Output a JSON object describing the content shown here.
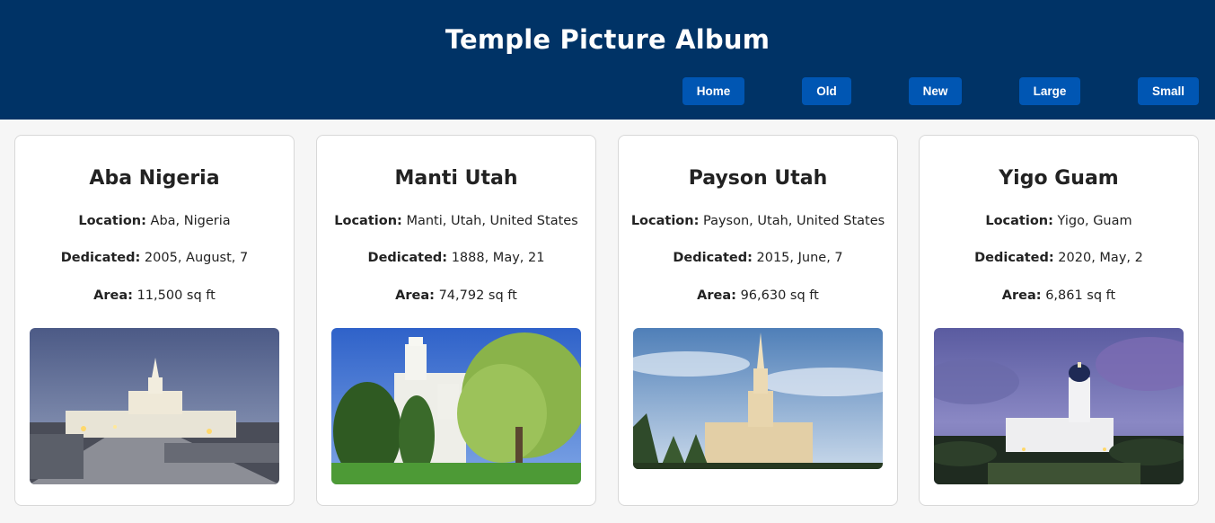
{
  "header": {
    "title": "Temple Picture Album",
    "nav": [
      "Home",
      "Old",
      "New",
      "Large",
      "Small"
    ]
  },
  "labels": {
    "location": "Location:",
    "dedicated": "Dedicated:",
    "area": "Area:"
  },
  "temples": [
    {
      "name": "Aba Nigeria",
      "location": "Aba, Nigeria",
      "dedicated": "2005, August, 7",
      "area": "11,500 sq ft"
    },
    {
      "name": "Manti Utah",
      "location": "Manti, Utah, United States",
      "dedicated": "1888, May, 21",
      "area": "74,792 sq ft"
    },
    {
      "name": "Payson Utah",
      "location": "Payson, Utah, United States",
      "dedicated": "2015, June, 7",
      "area": "96,630 sq ft"
    },
    {
      "name": "Yigo Guam",
      "location": "Yigo, Guam",
      "dedicated": "2020, May, 2",
      "area": "6,861 sq ft"
    }
  ],
  "colors": {
    "header_bg": "#003366",
    "button_bg": "#0056b3",
    "page_bg": "#f6f6f6"
  }
}
